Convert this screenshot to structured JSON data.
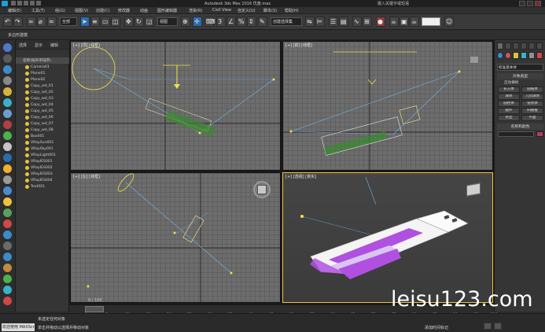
{
  "titlebar": {
    "title": "Autodesk 3ds Max 2016    优盘.max",
    "right_text": "键入关键字或短语"
  },
  "menubar": {
    "items": [
      "编辑(E)",
      "工具(T)",
      "组(G)",
      "视图(V)",
      "创建(C)",
      "修改器",
      "动画",
      "图形编辑器",
      "渲染(R)",
      "Civil View",
      "自定义(U)",
      "脚本(S)",
      "帮助(H)"
    ]
  },
  "toolbar": {
    "selection_filter": "全部",
    "view_select": "视图",
    "named_selection": "创建选择集"
  },
  "ribbon": {
    "label": "多边形建模"
  },
  "scene_explorer": {
    "tabs": [
      "选择",
      "显示",
      "编辑"
    ],
    "header": "名称(按升序排序)",
    "rows": [
      "Camera01",
      "Plane01",
      "Plane02",
      "Copy_wd_01",
      "Copy_wd_02",
      "Copy_wd_03",
      "Copy_wd_04",
      "Copy_wd_05",
      "Copy_wd_06",
      "Copy_wd_07",
      "Copy_wd_08",
      "Box001",
      "VRaySun001",
      "VRaySky001",
      "VRayLight001",
      "VRayIES001",
      "VRayIES002",
      "VRayIES003",
      "VRayIES004",
      "Text001"
    ]
  },
  "viewports": {
    "top_left_label": "[+] [顶] [线框]",
    "top_right_label": "[+] [前] [线框]",
    "bottom_left_label": "[+] [左] [线框]",
    "bottom_right_label": "[+] [透视] [真实]"
  },
  "command_panel": {
    "section_title": "对象类型",
    "auto_grid": "自动栅格",
    "buttons": [
      "长方体",
      "圆锥体",
      "球体",
      "几何球体",
      "圆柱体",
      "管状体",
      "圆环",
      "四棱锥",
      "茶壶",
      "平面"
    ],
    "name_section": "名称和颜色",
    "dropdown": "标准基本体"
  },
  "timeline": {
    "frame_display": "0 / 100",
    "ticks": [
      "0",
      "5",
      "10",
      "15",
      "20",
      "25",
      "30",
      "35",
      "40",
      "45",
      "50",
      "55",
      "60",
      "65",
      "70",
      "75",
      "80",
      "85",
      "90",
      "95",
      "100"
    ]
  },
  "statusbar": {
    "line1": "未选定任何对象",
    "line2": "单击并拖动以选择并移动对象",
    "maxscript": "欢迎使用 MAXScript。",
    "right_text": "添加时间标记"
  },
  "watermark": {
    "text": "leisu123.com"
  },
  "colors": {
    "accent_blue": "#2b6cb0",
    "selected_viewport_border": "#f0c040",
    "usb_body_purple": "#b050e0"
  }
}
